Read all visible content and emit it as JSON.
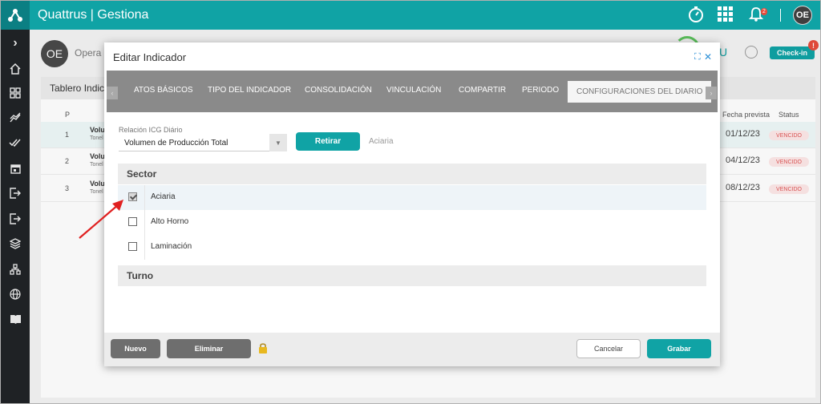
{
  "app": {
    "title": "Quattrus | Gestiona",
    "notification_count": "2",
    "user_initials": "OE"
  },
  "page": {
    "user_initials": "OE",
    "user_name": "Opera E",
    "status_letter": "U",
    "checkin_label": "Check-in",
    "checkin_alert": "!",
    "tablero_label": "Tablero Indica",
    "columns": {
      "p": "P",
      "fecha": "Fecha prevista",
      "status": "Status"
    },
    "rows": [
      {
        "num": "1",
        "title": "Volu",
        "sub": "Tonel",
        "date": "01/12/23",
        "status": "VENCIDO"
      },
      {
        "num": "2",
        "title": "Volu",
        "sub": "Tonel",
        "date": "04/12/23",
        "status": "VENCIDO"
      },
      {
        "num": "3",
        "title": "Volu",
        "sub": "Tonel",
        "date": "08/12/23",
        "status": "VENCIDO"
      }
    ]
  },
  "modal": {
    "title": "Editar Indicador",
    "tabs": [
      "ATOS BÁSICOS",
      "TIPO DEL INDICADOR",
      "CONSOLIDACIÓN",
      "VINCULACIÓN",
      "COMPARTIR",
      "PERIODO",
      "CONFIGURACIONES DEL DIARIO"
    ],
    "active_tab": "CONFIGURACIONES DEL DIARIO",
    "field_label": "Relación ICG Diário",
    "field_value": "Volumen de Producción Total",
    "retirar_label": "Retirar",
    "linked_value": "Aciaria",
    "sector_header": "Sector",
    "sectors": [
      {
        "name": "Aciaria",
        "checked": true
      },
      {
        "name": "Alto Horno",
        "checked": false
      },
      {
        "name": "Laminación",
        "checked": false
      }
    ],
    "turno_header": "Turno",
    "footer": {
      "nuevo": "Nuevo",
      "eliminar": "Eliminar",
      "cancelar": "Cancelar",
      "grabar": "Grabar"
    }
  },
  "colors": {
    "brand": "#10a3a5",
    "sidebar": "#1f2225",
    "alert": "#e74c3c"
  }
}
